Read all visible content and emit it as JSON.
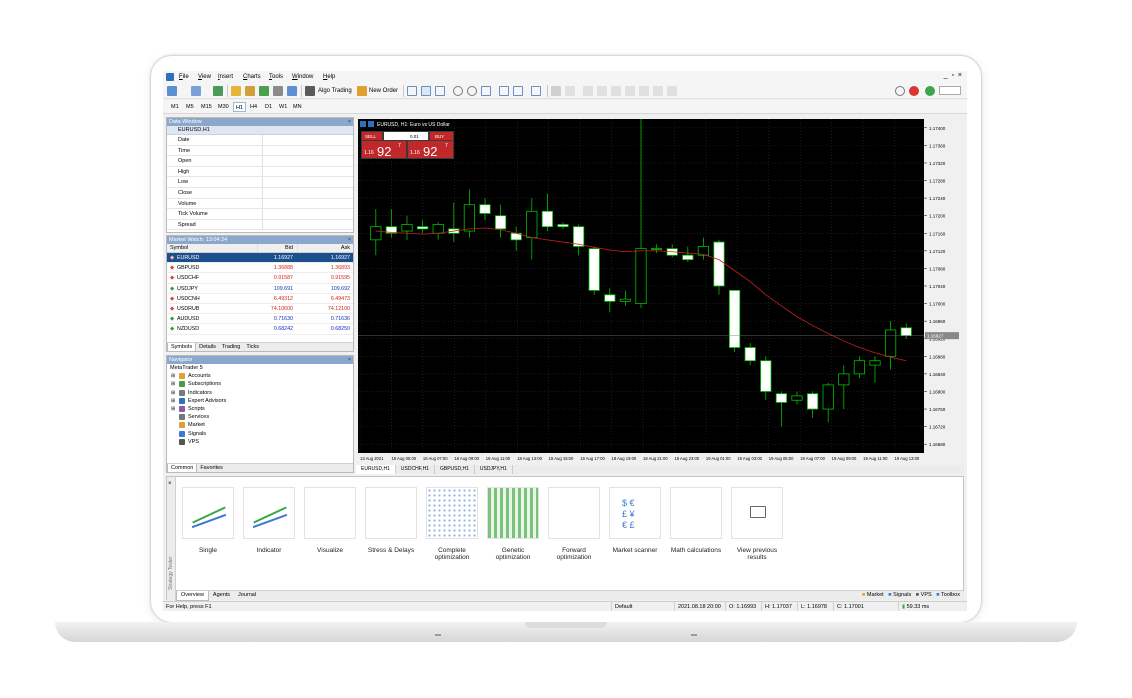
{
  "menu": [
    "File",
    "View",
    "Insert",
    "Charts",
    "Tools",
    "Window",
    "Help"
  ],
  "window_controls": "_ ▫ ×",
  "toolbar": {
    "algo_trading": "Algo Trading",
    "new_order": "New Order"
  },
  "periods": [
    "M1",
    "M5",
    "M15",
    "M30",
    "H1",
    "H4",
    "D1",
    "W1",
    "MN"
  ],
  "active_period": "H1",
  "data_window": {
    "title": "Data Window",
    "symbol": "EURUSD,H1",
    "rows": [
      "Date",
      "Time",
      "Open",
      "High",
      "Low",
      "Close",
      "Volume",
      "Tick Volume",
      "Spread"
    ]
  },
  "market_watch": {
    "title": "Market Watch: 13:04:24",
    "headers": {
      "symbol": "Symbol",
      "bid": "Bid",
      "ask": "Ask"
    },
    "rows": [
      {
        "symbol": "EURUSD",
        "bid": "1.16927",
        "ask": "1.16927",
        "dir": "down"
      },
      {
        "symbol": "GBPUSD",
        "bid": "1.36888",
        "ask": "1.36893",
        "dir": "down"
      },
      {
        "symbol": "USDCHF",
        "bid": "0.91587",
        "ask": "0.91595",
        "dir": "down"
      },
      {
        "symbol": "USDJPY",
        "bid": "109.691",
        "ask": "109.692",
        "dir": "up"
      },
      {
        "symbol": "USDCNH",
        "bid": "6.49312",
        "ask": "6.49473",
        "dir": "down"
      },
      {
        "symbol": "USDRUB",
        "bid": "74.10600",
        "ask": "74.12100",
        "dir": "down"
      },
      {
        "symbol": "AUDUSD",
        "bid": "0.71630",
        "ask": "0.71636",
        "dir": "up"
      },
      {
        "symbol": "NZDUSD",
        "bid": "0.68242",
        "ask": "0.68250",
        "dir": "up"
      }
    ],
    "tabs": [
      "Symbols",
      "Details",
      "Trading",
      "Ticks"
    ]
  },
  "navigator": {
    "title": "Navigator",
    "root": "MetaTrader 5",
    "items": [
      "Accounts",
      "Subscriptions",
      "Indicators",
      "Expert Advisors",
      "Scripts",
      "Services",
      "Market",
      "Signals",
      "VPS"
    ],
    "tabs": [
      "Common",
      "Favorites"
    ]
  },
  "chart": {
    "title": "EURUSD, H1: Euro vs US Dollar",
    "sell_label": "SELL",
    "buy_label": "BUY",
    "lot": "0.01",
    "sell_big_prefix": "1.16",
    "sell_big": "92",
    "sell_sup": "7",
    "buy_big_prefix": "1.16",
    "buy_big": "92",
    "buy_sup": "7",
    "current_price_label": "1.16927",
    "tabs": [
      "EURUSD,H1",
      "USDCHF,H1",
      "GBPUSD,H1",
      "USDJPY,H1"
    ],
    "colors": {
      "bg": "#000000",
      "bull": "#ffffff",
      "bear": "#ffffff",
      "wick": "#00c000",
      "grid": "#2b2b2b",
      "ma": "#c82020",
      "accent": "#1c4f8d"
    }
  },
  "chart_data": {
    "type": "candlestick",
    "title": "EURUSD, H1: Euro vs US Dollar",
    "y_ticks": [
      "1.17400",
      "1.17360",
      "1.17320",
      "1.17280",
      "1.17240",
      "1.17200",
      "1.17160",
      "1.17120",
      "1.17080",
      "1.17040",
      "1.17000",
      "1.16960",
      "1.16920",
      "1.16880",
      "1.16840",
      "1.16800",
      "1.16760",
      "1.16720",
      "1.16680"
    ],
    "x_ticks": [
      "13 Aug 2021",
      "18 Aug 05:00",
      "18 Aug 07:00",
      "18 Aug 09:00",
      "18 Aug 11:00",
      "18 Aug 13:00",
      "18 Aug 15:00",
      "18 Aug 17:00",
      "18 Aug 19:00",
      "18 Aug 21:00",
      "18 Aug 23:00",
      "19 Aug 01:00",
      "19 Aug 03:00",
      "19 Aug 05:00",
      "19 Aug 07:00",
      "19 Aug 09:00",
      "19 Aug 11:00",
      "19 Aug 13:00"
    ],
    "ylim": [
      1.1666,
      1.1742
    ],
    "candles": [
      {
        "o": 1.17145,
        "h": 1.17215,
        "l": 1.1711,
        "c": 1.17175
      },
      {
        "o": 1.17175,
        "h": 1.17215,
        "l": 1.1715,
        "c": 1.1716
      },
      {
        "o": 1.17165,
        "h": 1.172,
        "l": 1.17145,
        "c": 1.1718
      },
      {
        "o": 1.17175,
        "h": 1.1719,
        "l": 1.1716,
        "c": 1.1717
      },
      {
        "o": 1.1716,
        "h": 1.17185,
        "l": 1.17145,
        "c": 1.1718
      },
      {
        "o": 1.1717,
        "h": 1.1723,
        "l": 1.1714,
        "c": 1.1716
      },
      {
        "o": 1.17165,
        "h": 1.1726,
        "l": 1.1715,
        "c": 1.17225
      },
      {
        "o": 1.17225,
        "h": 1.1724,
        "l": 1.1719,
        "c": 1.17205
      },
      {
        "o": 1.172,
        "h": 1.17225,
        "l": 1.1715,
        "c": 1.1717
      },
      {
        "o": 1.1716,
        "h": 1.17175,
        "l": 1.1712,
        "c": 1.17145
      },
      {
        "o": 1.1715,
        "h": 1.1724,
        "l": 1.171,
        "c": 1.1721
      },
      {
        "o": 1.1721,
        "h": 1.1725,
        "l": 1.17165,
        "c": 1.17175
      },
      {
        "o": 1.1718,
        "h": 1.17185,
        "l": 1.1717,
        "c": 1.17175
      },
      {
        "o": 1.17175,
        "h": 1.1718,
        "l": 1.1711,
        "c": 1.1713
      },
      {
        "o": 1.17125,
        "h": 1.1713,
        "l": 1.1702,
        "c": 1.1703
      },
      {
        "o": 1.1702,
        "h": 1.17035,
        "l": 1.1698,
        "c": 1.17005
      },
      {
        "o": 1.17005,
        "h": 1.1703,
        "l": 1.16995,
        "c": 1.1701
      },
      {
        "o": 1.17,
        "h": 1.1742,
        "l": 1.1699,
        "c": 1.17125
      },
      {
        "o": 1.17125,
        "h": 1.17135,
        "l": 1.17115,
        "c": 1.17125
      },
      {
        "o": 1.17125,
        "h": 1.17135,
        "l": 1.17105,
        "c": 1.1711
      },
      {
        "o": 1.1711,
        "h": 1.1713,
        "l": 1.17095,
        "c": 1.171
      },
      {
        "o": 1.1711,
        "h": 1.1715,
        "l": 1.171,
        "c": 1.1713
      },
      {
        "o": 1.1714,
        "h": 1.17145,
        "l": 1.1702,
        "c": 1.1704
      },
      {
        "o": 1.1703,
        "h": 1.1703,
        "l": 1.1689,
        "c": 1.169
      },
      {
        "o": 1.169,
        "h": 1.1691,
        "l": 1.1686,
        "c": 1.1687
      },
      {
        "o": 1.1687,
        "h": 1.1688,
        "l": 1.1678,
        "c": 1.168
      },
      {
        "o": 1.16795,
        "h": 1.168,
        "l": 1.1672,
        "c": 1.16775
      },
      {
        "o": 1.1678,
        "h": 1.168,
        "l": 1.1677,
        "c": 1.1679
      },
      {
        "o": 1.16795,
        "h": 1.168,
        "l": 1.1674,
        "c": 1.1676
      },
      {
        "o": 1.1676,
        "h": 1.1682,
        "l": 1.1673,
        "c": 1.16815
      },
      {
        "o": 1.16815,
        "h": 1.1686,
        "l": 1.1676,
        "c": 1.1684
      },
      {
        "o": 1.1684,
        "h": 1.1688,
        "l": 1.1683,
        "c": 1.1687
      },
      {
        "o": 1.1686,
        "h": 1.1688,
        "l": 1.1682,
        "c": 1.1687
      },
      {
        "o": 1.1688,
        "h": 1.1696,
        "l": 1.1685,
        "c": 1.1694
      },
      {
        "o": 1.16945,
        "h": 1.16955,
        "l": 1.1692,
        "c": 1.16927
      }
    ],
    "ma": [
      1.17165,
      1.17162,
      1.1716,
      1.17158,
      1.1716,
      1.17165,
      1.1717,
      1.17172,
      1.17168,
      1.1716,
      1.1715,
      1.17145,
      1.1714,
      1.17135,
      1.17128,
      1.17122,
      1.17118,
      1.1712,
      1.1712,
      1.17118,
      1.17115,
      1.17112,
      1.171,
      1.17075,
      1.1705,
      1.1702,
      1.16995,
      1.1697,
      1.1695,
      1.16932,
      1.16915,
      1.169,
      1.16888,
      1.16878,
      1.1687
    ]
  },
  "tester": {
    "cards": [
      {
        "label": "Single"
      },
      {
        "label": "Indicator"
      },
      {
        "label": "Visualize"
      },
      {
        "label": "Stress & Delays"
      },
      {
        "label": "Complete optimization"
      },
      {
        "label": "Genetic optimization"
      },
      {
        "label": "Forward optimization"
      },
      {
        "label": "Market scanner"
      },
      {
        "label": "Math calculations"
      },
      {
        "label": "View previous results"
      }
    ],
    "tabs": [
      "Overview",
      "Agents",
      "Journal"
    ],
    "right_links": [
      "Market",
      "Signals",
      "VPS",
      "Toolbox"
    ],
    "side_label": "Strategy Tester"
  },
  "statusbar": {
    "help": "For Help, press F1",
    "profile": "Default",
    "datetime": "2021.08.18 20:00",
    "open": "O: 1.16993",
    "high": "H: 1.17037",
    "low": "L: 1.16978",
    "close": "C: 1.17001",
    "ping": "59.33 ms"
  }
}
